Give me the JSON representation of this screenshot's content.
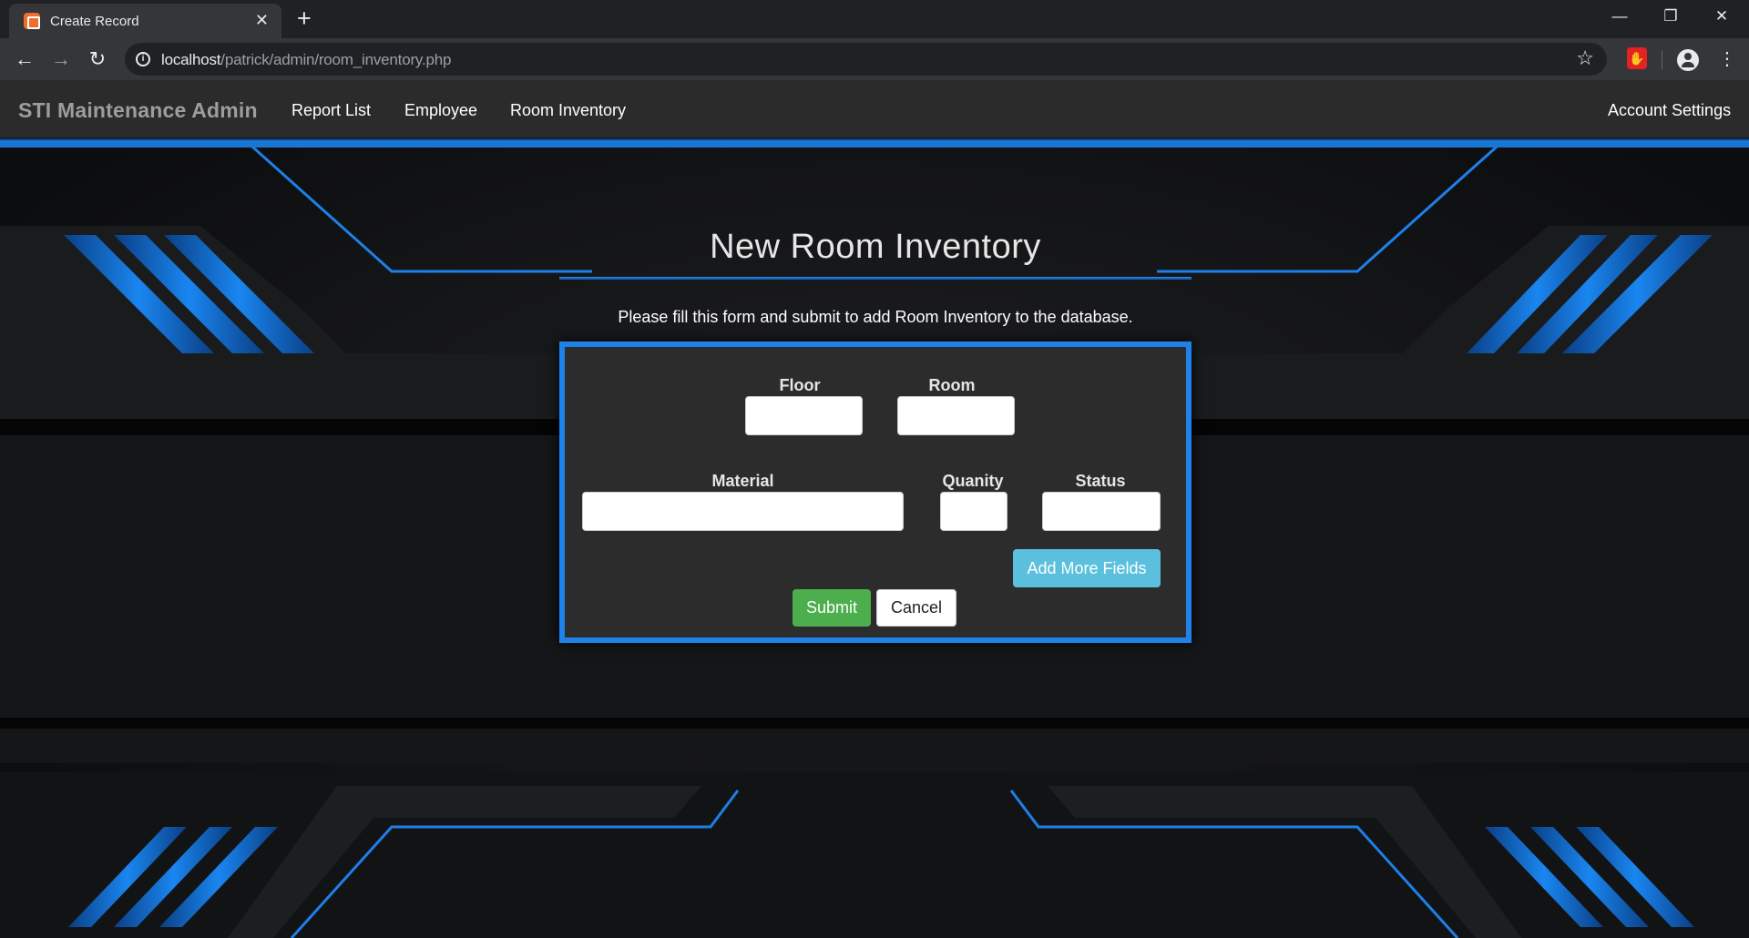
{
  "browser": {
    "tab_title": "Create Record",
    "url_host": "localhost",
    "url_path": "/patrick/admin/room_inventory.php",
    "icons": [
      "close-icon",
      "plus-icon",
      "back-icon",
      "forward-icon",
      "reload-icon",
      "info-icon",
      "star-icon",
      "extension-icon",
      "account-icon",
      "menu-icon",
      "minimize-icon",
      "restore-icon",
      "window-close-icon"
    ]
  },
  "navbar": {
    "brand": "STI Maintenance Admin",
    "links": [
      "Report List",
      "Employee",
      "Room Inventory"
    ],
    "account": "Account Settings",
    "accent_color": "#1976d2"
  },
  "main": {
    "title": "New Room Inventory",
    "instructions": "Please fill this form and submit to add Room Inventory to the database."
  },
  "form": {
    "floor_label": "Floor",
    "room_label": "Room",
    "material_label": "Material",
    "quantity_label": "Quanity",
    "status_label": "Status",
    "floor_value": "",
    "room_value": "",
    "material_value": "",
    "quantity_value": "",
    "status_value": "",
    "add_more_label": "Add More Fields",
    "submit_label": "Submit",
    "cancel_label": "Cancel",
    "panel_border_color": "#1f82e8",
    "submit_color": "#4cae4c",
    "add_more_color": "#5bc0de"
  }
}
